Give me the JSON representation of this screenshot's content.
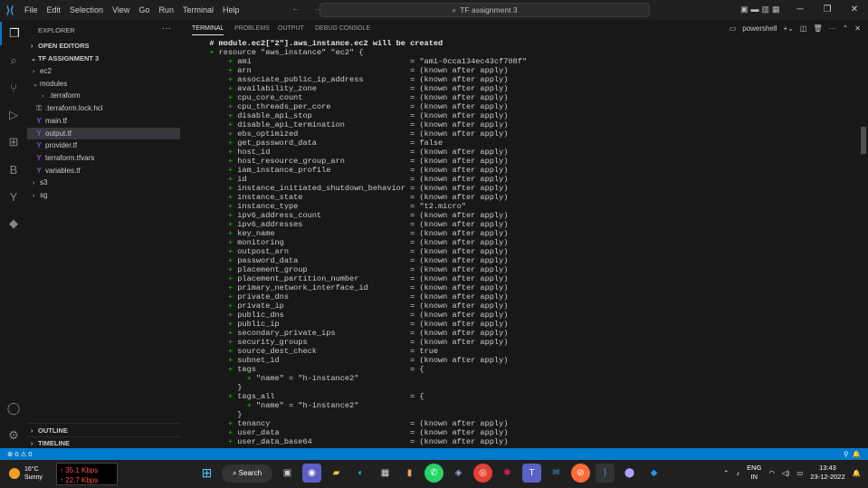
{
  "titlebar": {
    "menu": [
      "File",
      "Edit",
      "Selection",
      "View",
      "Go",
      "Run",
      "Terminal",
      "Help"
    ],
    "search_text": "TF assignment 3",
    "window_controls": [
      "minimize-icon",
      "restore-icon",
      "close-icon"
    ]
  },
  "activity_bar": [
    "explorer-icon",
    "search-icon",
    "source-control-icon",
    "run-debug-icon",
    "extensions-icon",
    "b-extension-icon",
    "git-graph-icon",
    "docker-icon",
    "account-icon",
    "settings-icon"
  ],
  "sidebar": {
    "title": "EXPLORER",
    "open_editors": "OPEN EDITORS",
    "project": "TF ASSIGNMENT 3",
    "items": [
      {
        "label": "ec2",
        "type": "folder",
        "expanded": false
      },
      {
        "label": "modules",
        "type": "folder",
        "expanded": true
      },
      {
        "label": ".terraform",
        "type": "folder",
        "expanded": false
      },
      {
        "label": ".terraform.lock.hcl",
        "type": "lock"
      },
      {
        "label": "main.tf",
        "type": "tf"
      },
      {
        "label": "output.tf",
        "type": "tf",
        "selected": true
      },
      {
        "label": "provider.tf",
        "type": "tf"
      },
      {
        "label": "terraform.tfvars",
        "type": "tf"
      },
      {
        "label": "variables.tf",
        "type": "tf"
      },
      {
        "label": "s3",
        "type": "folder",
        "expanded": false
      },
      {
        "label": "sg",
        "type": "folder",
        "expanded": false
      }
    ],
    "outline": "OUTLINE",
    "timeline": "TIMELINE"
  },
  "panel": {
    "tabs": [
      "TERMINAL",
      "PROBLEMS",
      "OUTPUT",
      "DEBUG CONSOLE"
    ],
    "active_tab": "TERMINAL",
    "shell": "powershell",
    "lines": [
      {
        "prefix": "  # ",
        "text": "module.ec2[\"2\"].aws_instance.ec2 will be created",
        "hash": true
      },
      {
        "prefix": "  + ",
        "text": "resource \"aws_instance\" \"ec2\" {"
      },
      {
        "prefix": "      + ",
        "text": "ami                                  = \"ami-0cca134ec43cf708f\""
      },
      {
        "prefix": "      + ",
        "text": "arn                                  = (known after apply)"
      },
      {
        "prefix": "      + ",
        "text": "associate_public_ip_address          = (known after apply)"
      },
      {
        "prefix": "      + ",
        "text": "availability_zone                    = (known after apply)"
      },
      {
        "prefix": "      + ",
        "text": "cpu_core_count                       = (known after apply)"
      },
      {
        "prefix": "      + ",
        "text": "cpu_threads_per_core                 = (known after apply)"
      },
      {
        "prefix": "      + ",
        "text": "disable_api_stop                     = (known after apply)"
      },
      {
        "prefix": "      + ",
        "text": "disable_api_termination              = (known after apply)"
      },
      {
        "prefix": "      + ",
        "text": "ebs_optimized                        = (known after apply)"
      },
      {
        "prefix": "      + ",
        "text": "get_password_data                    = false"
      },
      {
        "prefix": "      + ",
        "text": "host_id                              = (known after apply)"
      },
      {
        "prefix": "      + ",
        "text": "host_resource_group_arn              = (known after apply)"
      },
      {
        "prefix": "      + ",
        "text": "iam_instance_profile                 = (known after apply)"
      },
      {
        "prefix": "      + ",
        "text": "id                                   = (known after apply)"
      },
      {
        "prefix": "      + ",
        "text": "instance_initiated_shutdown_behavior = (known after apply)"
      },
      {
        "prefix": "      + ",
        "text": "instance_state                       = (known after apply)"
      },
      {
        "prefix": "      + ",
        "text": "instance_type                        = \"t2.micro\""
      },
      {
        "prefix": "      + ",
        "text": "ipv6_address_count                   = (known after apply)"
      },
      {
        "prefix": "      + ",
        "text": "ipv6_addresses                       = (known after apply)"
      },
      {
        "prefix": "      + ",
        "text": "key_name                             = (known after apply)"
      },
      {
        "prefix": "      + ",
        "text": "monitoring                           = (known after apply)"
      },
      {
        "prefix": "      + ",
        "text": "outpost_arn                          = (known after apply)"
      },
      {
        "prefix": "      + ",
        "text": "password_data                        = (known after apply)"
      },
      {
        "prefix": "      + ",
        "text": "placement_group                      = (known after apply)"
      },
      {
        "prefix": "      + ",
        "text": "placement_partition_number           = (known after apply)"
      },
      {
        "prefix": "      + ",
        "text": "primary_network_interface_id         = (known after apply)"
      },
      {
        "prefix": "      + ",
        "text": "private_dns                          = (known after apply)"
      },
      {
        "prefix": "      + ",
        "text": "private_ip                           = (known after apply)"
      },
      {
        "prefix": "      + ",
        "text": "public_dns                           = (known after apply)"
      },
      {
        "prefix": "      + ",
        "text": "public_ip                            = (known after apply)"
      },
      {
        "prefix": "      + ",
        "text": "secondary_private_ips                = (known after apply)"
      },
      {
        "prefix": "      + ",
        "text": "security_groups                      = (known after apply)"
      },
      {
        "prefix": "      + ",
        "text": "source_dest_check                    = true"
      },
      {
        "prefix": "      + ",
        "text": "subnet_id                            = (known after apply)"
      },
      {
        "prefix": "      + ",
        "text": "tags                                 = {"
      },
      {
        "prefix": "          + ",
        "text": "\"name\" = \"h-instance2\""
      },
      {
        "prefix": "        ",
        "text": "}"
      },
      {
        "prefix": "      + ",
        "text": "tags_all                             = {"
      },
      {
        "prefix": "          + ",
        "text": "\"name\" = \"h-instance2\""
      },
      {
        "prefix": "        ",
        "text": "}"
      },
      {
        "prefix": "      + ",
        "text": "tenancy                              = (known after apply)"
      },
      {
        "prefix": "      + ",
        "text": "user_data                            = (known after apply)"
      },
      {
        "prefix": "      + ",
        "text": "user_data_base64                     = (known after apply)"
      }
    ]
  },
  "statusbar": {
    "errors": "⊗ 0 ⚠ 0"
  },
  "taskbar": {
    "temperature": "16°C",
    "weather": "Sunny",
    "net_up": "↑ 35.1 Kbps",
    "net_down": "↑ 22.7 Kbps",
    "search": "Search",
    "lang1": "ENG",
    "lang2": "IN",
    "time": "13:43",
    "date": "23-12-2022"
  }
}
